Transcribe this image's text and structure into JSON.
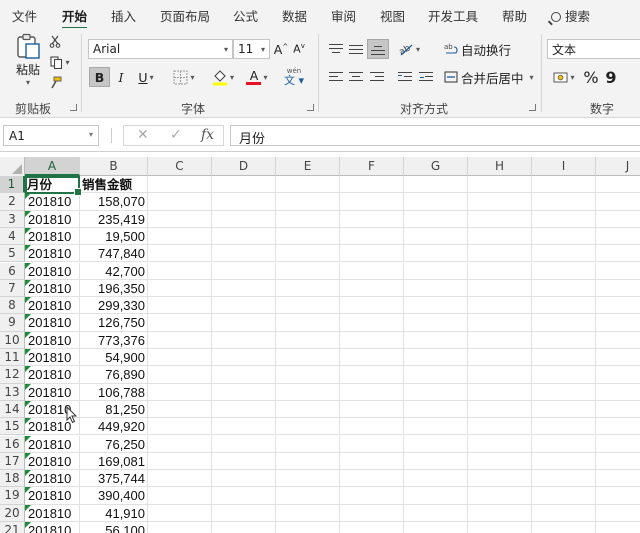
{
  "ribbon_tabs": [
    {
      "label": "文件"
    },
    {
      "label": "开始"
    },
    {
      "label": "插入"
    },
    {
      "label": "页面布局"
    },
    {
      "label": "公式"
    },
    {
      "label": "数据"
    },
    {
      "label": "审阅"
    },
    {
      "label": "视图"
    },
    {
      "label": "开发工具"
    },
    {
      "label": "帮助"
    },
    {
      "label": "搜索"
    }
  ],
  "active_tab": "开始",
  "clipboard": {
    "paste_label": "粘贴",
    "group_label": "剪贴板"
  },
  "font": {
    "font_name": "Arial",
    "font_size": "11",
    "grow_label": "A",
    "shrink_label": "A",
    "bold_label": "B",
    "italic_label": "I",
    "underline_label": "U",
    "font_color_label": "A",
    "phonetic_label": "wén",
    "group_label": "字体"
  },
  "alignment": {
    "wrap_text_label": "自动换行",
    "merge_center_label": "合并后居中",
    "group_label": "对齐方式"
  },
  "number": {
    "format_value": "文本",
    "percent_label": "%",
    "comma_label": "9",
    "group_label": "数字"
  },
  "colors": {
    "accent": "#217346",
    "highlight_yellow": "#ffff00",
    "font_red": "#e81123",
    "error_flag": "#1f8a3b"
  },
  "formula_bar": {
    "name_box": "A1",
    "cancel_icon": "✕",
    "enter_icon": "✓",
    "fx_label": "fx",
    "content": "月份"
  },
  "sheet": {
    "columns": [
      "A",
      "B",
      "C",
      "D",
      "E",
      "F",
      "G",
      "H",
      "I",
      "J"
    ],
    "rows": [
      {
        "num": "1",
        "a": "月份",
        "b": "销售金额"
      },
      {
        "num": "2",
        "a": "201810",
        "b": "158,070"
      },
      {
        "num": "3",
        "a": "201810",
        "b": "235,419"
      },
      {
        "num": "4",
        "a": "201810",
        "b": "19,500"
      },
      {
        "num": "5",
        "a": "201810",
        "b": "747,840"
      },
      {
        "num": "6",
        "a": "201810",
        "b": "42,700"
      },
      {
        "num": "7",
        "a": "201810",
        "b": "196,350"
      },
      {
        "num": "8",
        "a": "201810",
        "b": "299,330"
      },
      {
        "num": "9",
        "a": "201810",
        "b": "126,750"
      },
      {
        "num": "10",
        "a": "201810",
        "b": "773,376"
      },
      {
        "num": "11",
        "a": "201810",
        "b": "54,900"
      },
      {
        "num": "12",
        "a": "201810",
        "b": "76,890"
      },
      {
        "num": "13",
        "a": "201810",
        "b": "106,788"
      },
      {
        "num": "14",
        "a": "201810",
        "b": "81,250"
      },
      {
        "num": "15",
        "a": "201810",
        "b": "449,920"
      },
      {
        "num": "16",
        "a": "201810",
        "b": "76,250"
      },
      {
        "num": "17",
        "a": "201810",
        "b": "169,081"
      },
      {
        "num": "18",
        "a": "201810",
        "b": "375,744"
      },
      {
        "num": "19",
        "a": "201810",
        "b": "390,400"
      },
      {
        "num": "20",
        "a": "201810",
        "b": "41,910"
      },
      {
        "num": "21",
        "a": "201810",
        "b": "56,100"
      }
    ]
  }
}
